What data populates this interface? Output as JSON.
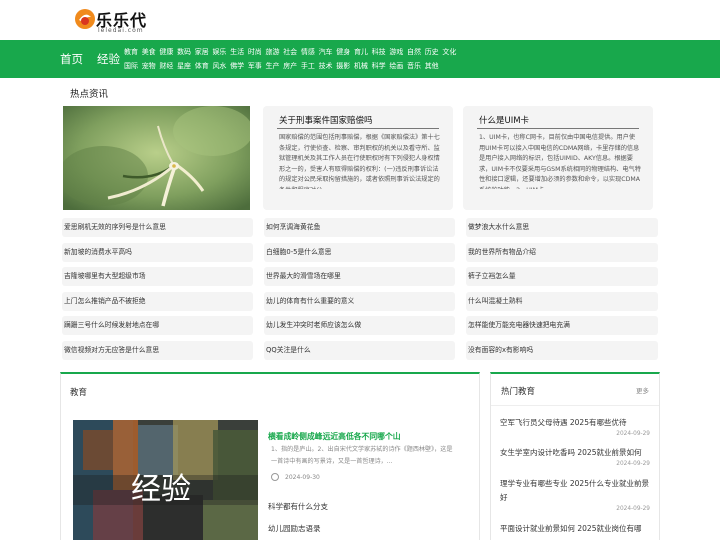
{
  "brand": {
    "name": "乐乐代",
    "domain": "leledai.com"
  },
  "nav": {
    "home": "首页",
    "experience": "经验",
    "row1": [
      "教育",
      "美食",
      "健康",
      "数码",
      "家居",
      "娱乐",
      "生活",
      "时尚",
      "旅游",
      "社会",
      "情感",
      "汽车",
      "健身",
      "育儿",
      "科技",
      "游戏",
      "自然",
      "历史",
      "文化"
    ],
    "row2": [
      "国际",
      "宠物",
      "财经",
      "星座",
      "体育",
      "风水",
      "佛学",
      "军事",
      "生产",
      "房产",
      "手工",
      "技术",
      "摄影",
      "机械",
      "科学",
      "绘画",
      "音乐",
      "其他"
    ]
  },
  "hot_news": {
    "title": "热点资讯",
    "cards": [
      {
        "title": "关于刑事案件国家赔偿吗",
        "body": "国家赔偿的范围包括刑事赔偿，根据《国家赔偿法》第十七条规定，行使侦查、检察、审判职权的机关以及看守所、监狱管理机关及其工作人员在行使职权时有下列侵犯人身权情形之一的，受害人有取得赔偿的权利：(一)违反刑事诉讼法的规定对公民采取拘留措施的，或者依照刑事诉讼法规定的条件和程序对公..."
      },
      {
        "title": "什么是UIM卡",
        "body": "1、UIM卡，也称C网卡，目前仅由中国电信提供。用户使用UIM卡可以接入中国电信的CDMA网络，卡里存储的信息是用户接入网络的标识，包括UIMID、AKY信息。根据要求，UIM卡不仅要采用与GSM系统相同的物理结构、电气特性和接口逻辑，还要增加必须的参数和命令，以实现CDMA系统的功能。2、UIM卡..."
      }
    ],
    "list": [
      [
        "爱思刷机无效的序列号是什么意思",
        "如何烹调海黄花鱼",
        "做梦浪大水什么意思"
      ],
      [
        "新加坡的消费水平高吗",
        "白细胞0-5是什么意思",
        "我的世界所有物品介绍"
      ],
      [
        "吉隆坡哪里有大型超级市场",
        "世界最大的滑雪场在哪里",
        "裤子立裆怎么量"
      ],
      [
        "上门怎么推销产品不被拒绝",
        "幼儿的体育有什么重要的意义",
        "什么叫混凝土熟料"
      ],
      [
        "蹒跚三号什么时候发射地点在哪",
        "幼儿发生冲突时老师应该怎么做",
        "怎样能使万能充电器快速把电充满"
      ],
      [
        "微信视频对方无应答是什么意思",
        "QQ关注是什么",
        "没有面容的x有影响吗"
      ]
    ]
  },
  "education": {
    "title": "教育",
    "image_caption": "经验",
    "featured": {
      "title": "横看成岭侧成峰远近高低各不同哪个山",
      "body": "1、指的是庐山。2、出自宋代文学家苏轼的诗作《题西林壁》，这是一首诗中有画的写景诗，又是一首哲理诗，...",
      "date": "2024-09-30"
    },
    "links": [
      "科学都有什么分支",
      "幼儿园励志语录"
    ]
  },
  "hot_education": {
    "title": "热门教育",
    "more": "更多",
    "items": [
      {
        "title": "空军飞行员父母待遇 2025有哪些优待",
        "date": "2024-09-29"
      },
      {
        "title": "女生学室内设计吃香吗 2025就业前景如何",
        "date": "2024-09-29"
      },
      {
        "title": "理学专业有哪些专业 2025什么专业就业前景好",
        "date": "2024-09-29"
      },
      {
        "title": "平面设计就业前景如何 2025就业岗位有哪",
        "date": ""
      }
    ]
  }
}
